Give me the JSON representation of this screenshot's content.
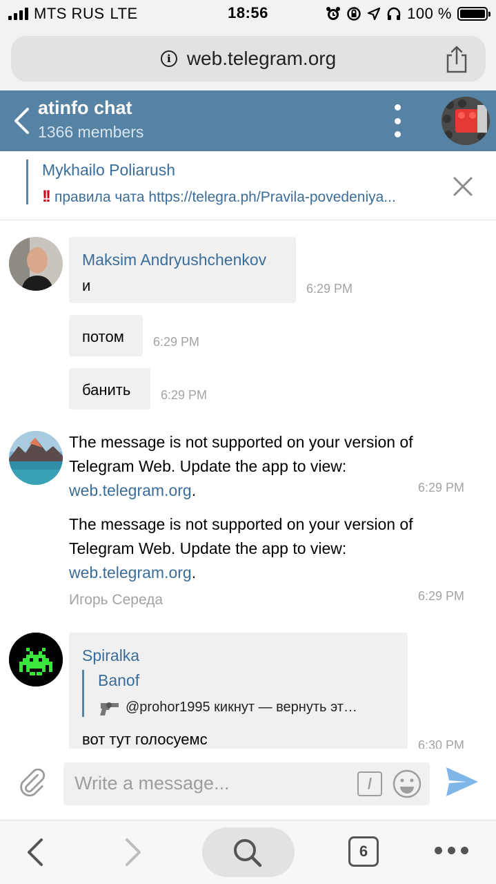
{
  "status_bar": {
    "carrier": "MTS RUS",
    "network": "LTE",
    "time": "18:56",
    "battery_percent": "100 %",
    "battery_level": 1.0,
    "icons": [
      "alarm-icon",
      "orientation-lock-icon",
      "location-icon",
      "headphones-icon"
    ]
  },
  "browser": {
    "url": "web.telegram.org",
    "tabs_count": "6"
  },
  "chat": {
    "title": "atinfo chat",
    "members": "1366 members"
  },
  "pinned": {
    "author": "Mykhailo Poliarush",
    "emoji": "!!",
    "text": "правила чата https://telegra.ph/Pravila-povedeniya..."
  },
  "messages": {
    "group1": {
      "sender": "Maksim Andryushchenkov",
      "items": [
        {
          "text": "и",
          "time": "6:29 PM"
        },
        {
          "text": "потом",
          "time": "6:29 PM"
        },
        {
          "text": "банить",
          "time": "6:29 PM"
        }
      ]
    },
    "group2": {
      "items": [
        {
          "text_before": "The message is not supported on your version of Telegram Web. Update the app to view: ",
          "link": "web.telegram.org",
          "text_after": ".",
          "time": "6:29 PM"
        },
        {
          "text_before": "The message is not supported on your version of Telegram Web. Update the app to view: ",
          "link": "web.telegram.org",
          "text_after": ".",
          "time": "6:29 PM"
        }
      ],
      "forwarded_from": "Игорь Середа",
      "forwarded_time": "6:29 PM"
    },
    "group3": {
      "sender": "Spiralka",
      "reply_name": "Banof",
      "reply_text": "@prohor1995 кикнут — вернуть эт…",
      "text": "вот тут голосуемс",
      "time": "6:30 PM"
    }
  },
  "composer": {
    "placeholder": "Write a message..."
  },
  "colors": {
    "header": "#5682a3",
    "link": "#3a6d99",
    "bubble": "#f0f0f0",
    "time": "#a3a3a3"
  }
}
